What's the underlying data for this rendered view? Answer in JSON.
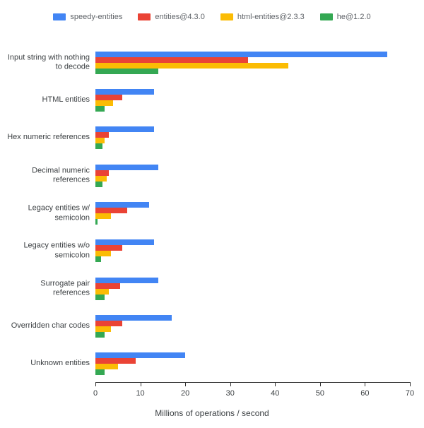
{
  "chart_data": {
    "type": "bar",
    "orientation": "horizontal",
    "xlabel": "Millions of operations / second",
    "ylabel": "",
    "xlim": [
      0,
      70
    ],
    "xticks": [
      0,
      10,
      20,
      30,
      40,
      50,
      60,
      70
    ],
    "categories": [
      "Input string with nothing to decode",
      "HTML entities",
      "Hex numeric references",
      "Decimal numeric references",
      "Legacy entities w/ semicolon",
      "Legacy entities w/o semicolon",
      "Surrogate pair references",
      "Overridden char codes",
      "Unknown entities"
    ],
    "series": [
      {
        "name": "speedy-entities",
        "color": "#4285f4",
        "values": [
          65,
          13,
          13,
          14,
          12,
          13,
          14,
          17,
          20
        ]
      },
      {
        "name": "entities@4.3.0",
        "color": "#ea4335",
        "values": [
          34,
          6,
          3,
          3,
          7,
          6,
          5.5,
          6,
          9
        ]
      },
      {
        "name": "html-entities@2.3.3",
        "color": "#fbbc04",
        "values": [
          43,
          4,
          2,
          2.5,
          3.5,
          3.5,
          3,
          3.5,
          5
        ]
      },
      {
        "name": "he@1.2.0",
        "color": "#34a853",
        "values": [
          14,
          2,
          1.5,
          1.5,
          0.5,
          1.2,
          2,
          2,
          2
        ]
      }
    ]
  }
}
